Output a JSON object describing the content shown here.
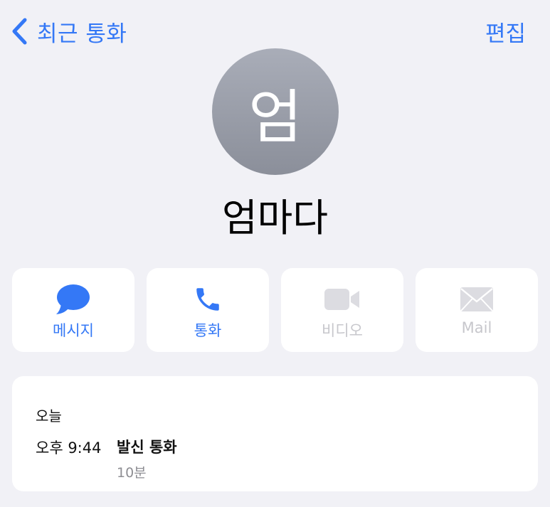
{
  "nav": {
    "back_label": "최근 통화",
    "edit_label": "편집"
  },
  "contact": {
    "initial": "엄",
    "name": "엄마다"
  },
  "actions": [
    {
      "label": "메시지",
      "icon": "message-bubble-icon",
      "enabled": true
    },
    {
      "label": "통화",
      "icon": "phone-icon",
      "enabled": true
    },
    {
      "label": "비디오",
      "icon": "video-camera-icon",
      "enabled": false
    },
    {
      "label": "Mail",
      "icon": "envelope-icon",
      "enabled": false
    }
  ],
  "history": {
    "day": "오늘",
    "entries": [
      {
        "time": "오후 9:44",
        "type": "발신 통화",
        "duration": "10분"
      }
    ]
  },
  "colors": {
    "accent": "#3478f6",
    "disabled": "#c7c7cc",
    "background": "#f1f1f6",
    "card": "#ffffff",
    "avatar_top": "#a9adb8",
    "avatar_bottom": "#8b8f9a",
    "secondary_text": "#8e8e93"
  }
}
